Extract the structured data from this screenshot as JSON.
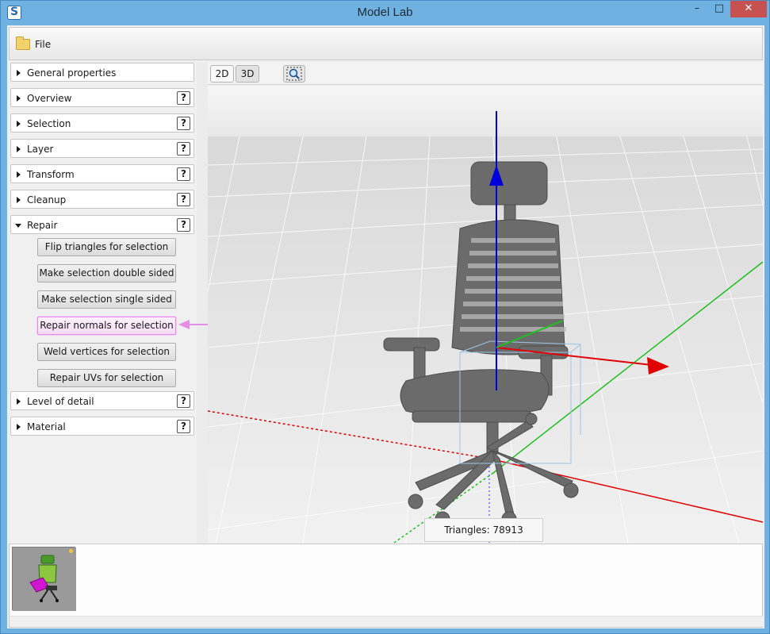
{
  "window": {
    "title": "Model Lab",
    "min_glyph": "–",
    "max_glyph": "□",
    "close_glyph": "✕"
  },
  "toolbar": {
    "file_label": "File"
  },
  "panels": [
    {
      "label": "General properties",
      "help": "",
      "open": false
    },
    {
      "label": "Overview",
      "help": "?",
      "open": false
    },
    {
      "label": "Selection",
      "help": "?",
      "open": false
    },
    {
      "label": "Layer",
      "help": "?",
      "open": false
    },
    {
      "label": "Transform",
      "help": "?",
      "open": false
    },
    {
      "label": "Cleanup",
      "help": "?",
      "open": false
    },
    {
      "label": "Repair",
      "help": "?",
      "open": true
    },
    {
      "label": "Level of detail",
      "help": "?",
      "open": false
    },
    {
      "label": "Material",
      "help": "?",
      "open": false
    }
  ],
  "repair_actions": [
    "Flip triangles for selection",
    "Make selection double sided",
    "Make selection single sided",
    "Repair normals for selection",
    "Weld vertices for selection",
    "Repair UVs for selection"
  ],
  "viewport": {
    "btn_2d": "2D",
    "btn_3d": "3D",
    "triangles_label": "Triangles:",
    "triangles_value": "78913"
  },
  "colors": {
    "axis_x": "#e00000",
    "axis_y": "#1fbf1f",
    "axis_z": "#0000dd",
    "highlight": "#e58ee5"
  }
}
